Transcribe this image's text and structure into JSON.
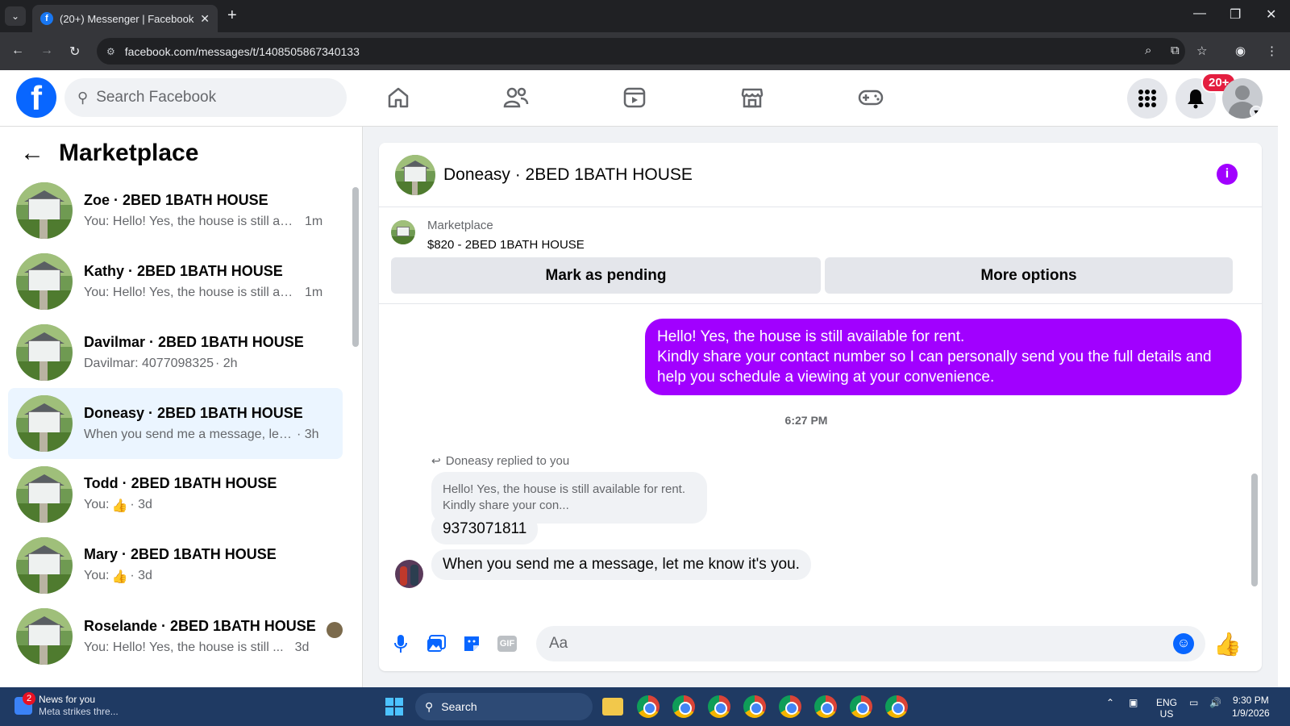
{
  "browser": {
    "tab_title": "(20+) Messenger | Facebook",
    "url": "facebook.com/messages/t/1408505867340133"
  },
  "header": {
    "search_placeholder": "Search Facebook",
    "notifications_badge": "20+"
  },
  "sidebar": {
    "title": "Marketplace",
    "conversations": [
      {
        "name": "Zoe · 2BED 1BATH HOUSE",
        "snippet": "You: Hello! Yes, the house is still av...",
        "time": "1m"
      },
      {
        "name": "Kathy · 2BED 1BATH HOUSE",
        "snippet": "You: Hello! Yes, the house is still av...",
        "time": "1m"
      },
      {
        "name": "Davilmar · 2BED 1BATH HOUSE",
        "snippet": "Davilmar: 4077098325",
        "time": "· 2h"
      },
      {
        "name": "Doneasy · 2BED 1BATH HOUSE",
        "snippet": "When you send me a message, let ...",
        "time": "· 3h"
      },
      {
        "name": "Todd · 2BED 1BATH HOUSE",
        "snippet": "You:",
        "time": "· 3d"
      },
      {
        "name": "Mary · 2BED 1BATH HOUSE",
        "snippet": "You:",
        "time": "· 3d"
      },
      {
        "name": "Roselande · 2BED 1BATH HOUSE",
        "snippet": "You: Hello! Yes, the house is still ...",
        "time": "3d"
      }
    ]
  },
  "chat": {
    "title": "Doneasy · 2BED 1BATH HOUSE",
    "marketplace_label": "Marketplace",
    "listing": "$820 - 2BED 1BATH HOUSE",
    "mark_pending": "Mark as pending",
    "more_options": "More options",
    "outgoing_message": [
      "Hello! Yes, the house is still available for rent.",
      "Kindly share your contact number so I can personally send you the full details and",
      "help you schedule a viewing at your convenience."
    ],
    "timestamp": "6:27 PM",
    "reply_note": "Doneasy replied to you",
    "quoted_line1": "Hello! Yes, the house is still available for rent.",
    "quoted_line2": "Kindly share your con...",
    "reply_message": "9373071811",
    "incoming_message": "When you send me a message, let me know it's you.",
    "composer_placeholder": "Aa"
  },
  "taskbar": {
    "news_title": "News for you",
    "news_sub": "Meta strikes thre...",
    "news_badge": "2",
    "search_label": "Search",
    "lang1": "ENG",
    "lang2": "US",
    "time": "9:30 PM",
    "date": "1/9/2026"
  },
  "colors": {
    "brand": "#0866ff",
    "outgoing_bubble": "#a100ff",
    "active_row": "#ebf5ff"
  }
}
